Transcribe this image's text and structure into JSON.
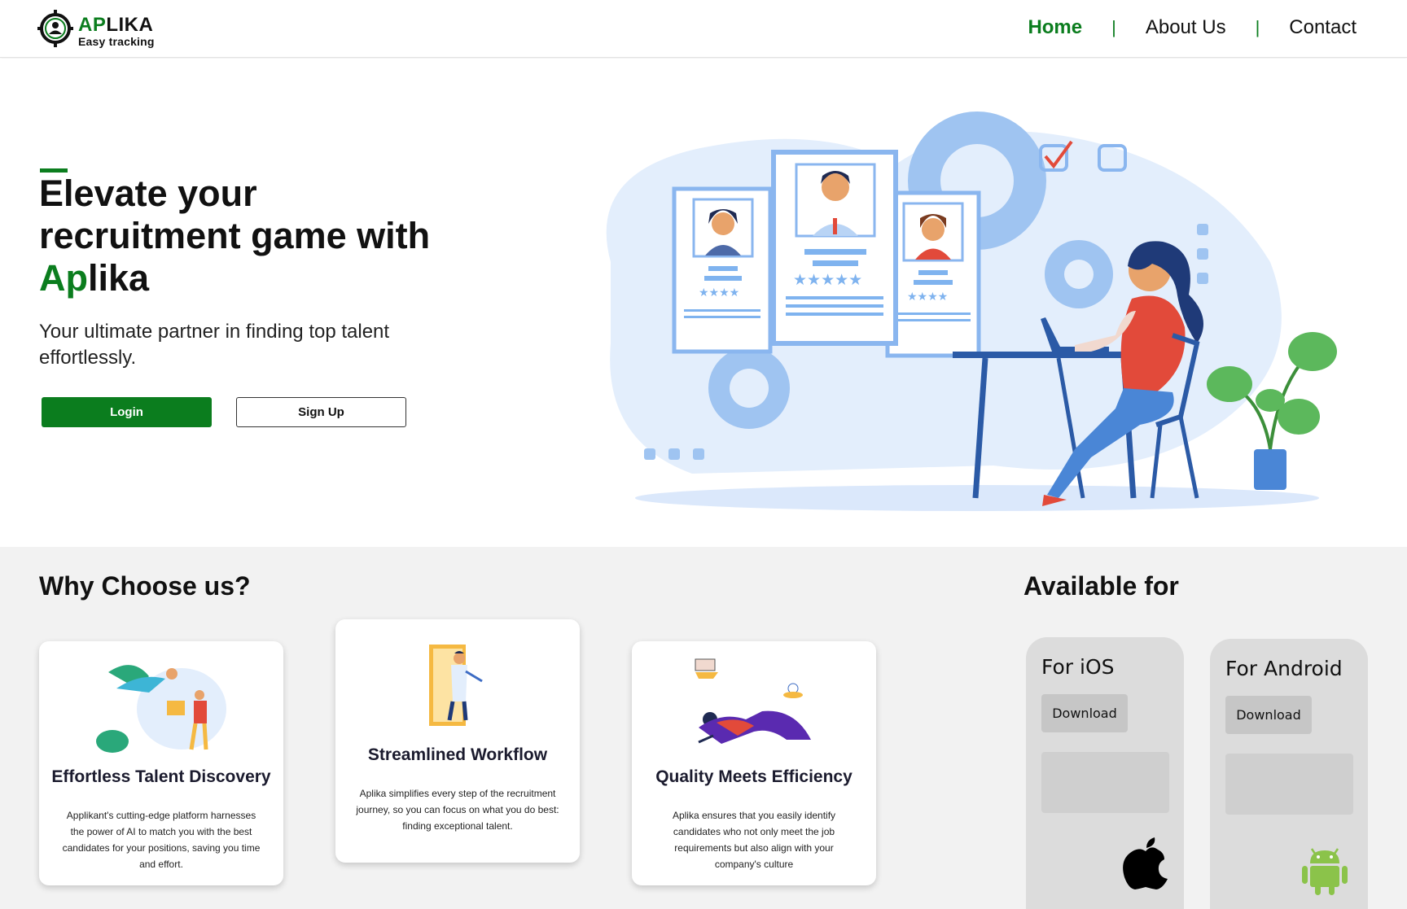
{
  "header": {
    "logo": {
      "name_green": "AP",
      "name_dark": "LIKA",
      "tagline": "Easy tracking"
    },
    "nav": [
      {
        "label": "Home"
      },
      {
        "label": "About Us"
      },
      {
        "label": "Contact"
      }
    ],
    "separator": "|"
  },
  "hero": {
    "title_line1": "Elevate your",
    "title_line2": "recruitment game with",
    "title_green": "Ap",
    "title_dark": "lika",
    "subtitle": " Your ultimate partner in finding top talent effortlessly.",
    "login_label": "Login",
    "signup_label": "Sign Up",
    "illustration_icon": "recruiter-at-laptop-illustration"
  },
  "why": {
    "title": "Why Choose us?",
    "cards": [
      {
        "title": "Effortless Talent Discovery",
        "description": "Applikant's cutting-edge platform harnesses the power of AI to match you with the best candidates for your positions, saving you time and effort.",
        "icon": "superhero-delivery-illustration"
      },
      {
        "title": "Streamlined Workflow",
        "description": "Aplika simplifies every step of the recruitment journey, so you can focus on what you do best: finding exceptional talent.",
        "icon": "person-through-door-illustration"
      },
      {
        "title": "Quality Meets Efficiency",
        "description": "Aplika ensures that you easily identify candidates who not only meet the job requirements but also align with your company's culture",
        "icon": "relaxing-person-illustration"
      }
    ]
  },
  "available": {
    "title": "Available for",
    "stores": [
      {
        "title": "For iOS",
        "button": "Download",
        "icon": "apple-icon"
      },
      {
        "title": "For Android",
        "button": "Download",
        "icon": "android-icon"
      }
    ]
  },
  "colors": {
    "brand_green": "#0b7d1e",
    "illustration_blue": "#7fb3ef",
    "android_green": "#8bc34a"
  }
}
